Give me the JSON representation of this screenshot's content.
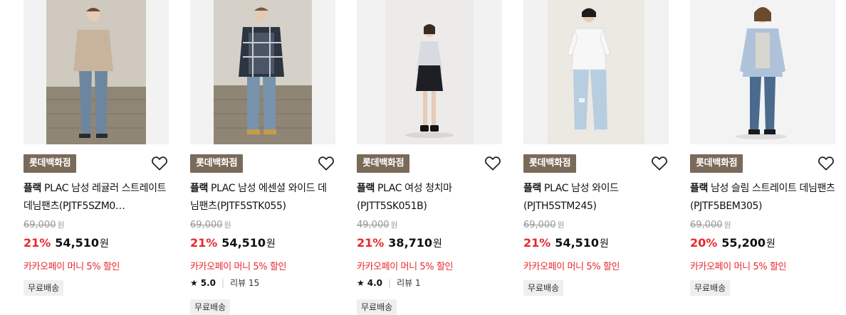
{
  "products": [
    {
      "store_badge": "롯데백화점",
      "brand": "플랙",
      "name": "PLAC 남성 레귤러 스트레이트 데님팬츠(PJTF5SZM0…",
      "original_price": "69,000",
      "original_unit": "원",
      "discount_rate": "21%",
      "sale_price": "54,510",
      "sale_unit": "원",
      "promo": "카카오페이 머니 5% 할인",
      "rating": null,
      "review": null,
      "shipping_tag": "무료배송"
    },
    {
      "store_badge": "롯데백화점",
      "brand": "플랙",
      "name": "PLAC 남성 에센셜 와이드 데님팬츠(PJTF5STK055)",
      "original_price": "69,000",
      "original_unit": "원",
      "discount_rate": "21%",
      "sale_price": "54,510",
      "sale_unit": "원",
      "promo": "카카오페이 머니 5% 할인",
      "rating": "5.0",
      "review": "리뷰 15",
      "shipping_tag": "무료배송"
    },
    {
      "store_badge": "롯데백화점",
      "brand": "플랙",
      "name": "PLAC 여성 청치마(PJTT5SK051B)",
      "original_price": "49,000",
      "original_unit": "원",
      "discount_rate": "21%",
      "sale_price": "38,710",
      "sale_unit": "원",
      "promo": "카카오페이 머니 5% 할인",
      "rating": "4.0",
      "review": "리뷰 1",
      "shipping_tag": "무료배송"
    },
    {
      "store_badge": "롯데백화점",
      "brand": "플랙",
      "name": "PLAC 남성 와이드(PJTH5STM245)",
      "original_price": "69,000",
      "original_unit": "원",
      "discount_rate": "21%",
      "sale_price": "54,510",
      "sale_unit": "원",
      "promo": "카카오페이 머니 5% 할인",
      "rating": null,
      "review": null,
      "shipping_tag": "무료배송"
    },
    {
      "store_badge": "롯데백화점",
      "brand": "플랙",
      "name": "남성 슬림 스트레이트 데님팬츠 (PJTF5BEM305)",
      "original_price": "69,000",
      "original_unit": "원",
      "discount_rate": "20%",
      "sale_price": "55,200",
      "sale_unit": "원",
      "promo": "카카오페이 머니 5% 할인",
      "rating": null,
      "review": null,
      "shipping_tag": "무료배송"
    }
  ],
  "icons": {
    "wishlist": "heart-outline-icon",
    "rating": "star-icon"
  },
  "colors": {
    "badge_bg": "#7a6a59",
    "discount": "#e8282b",
    "promo": "#e8282b",
    "tag_bg": "#efefef"
  }
}
